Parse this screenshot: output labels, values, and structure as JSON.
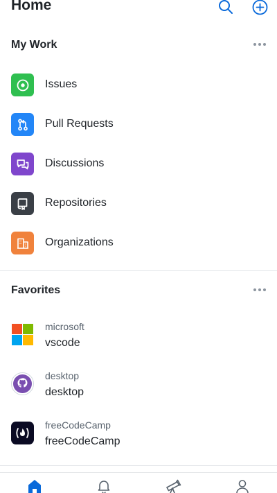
{
  "header": {
    "title": "Home",
    "search_icon": "search-icon",
    "add_icon": "plus-circle-icon"
  },
  "my_work": {
    "title": "My Work",
    "more_icon": "ellipsis-icon",
    "items": [
      {
        "label": "Issues",
        "icon": "issue-opened-icon",
        "color": "#2fbf50"
      },
      {
        "label": "Pull Requests",
        "icon": "git-pull-request-icon",
        "color": "#2386f7"
      },
      {
        "label": "Discussions",
        "icon": "comment-discussion-icon",
        "color": "#7f46cc"
      },
      {
        "label": "Repositories",
        "icon": "repo-icon",
        "color": "#3a3f46"
      },
      {
        "label": "Organizations",
        "icon": "organization-icon",
        "color": "#f0823c"
      }
    ]
  },
  "favorites": {
    "title": "Favorites",
    "more_icon": "ellipsis-icon",
    "items": [
      {
        "owner": "microsoft",
        "name": "vscode",
        "avatar": "microsoft-logo"
      },
      {
        "owner": "desktop",
        "name": "desktop",
        "avatar": "github-desktop-logo"
      },
      {
        "owner": "freeCodeCamp",
        "name": "freeCodeCamp",
        "avatar": "freecodecamp-logo"
      }
    ]
  },
  "tabbar": {
    "items": [
      {
        "name": "home",
        "icon": "home-icon",
        "active": true
      },
      {
        "name": "notifications",
        "icon": "bell-icon",
        "active": false
      },
      {
        "name": "explore",
        "icon": "telescope-icon",
        "active": false
      },
      {
        "name": "profile",
        "icon": "person-icon",
        "active": false
      }
    ]
  },
  "colors": {
    "accent": "#0969da",
    "text": "#1f2328",
    "muted": "#59636e",
    "divider": "#e4e6e9"
  }
}
